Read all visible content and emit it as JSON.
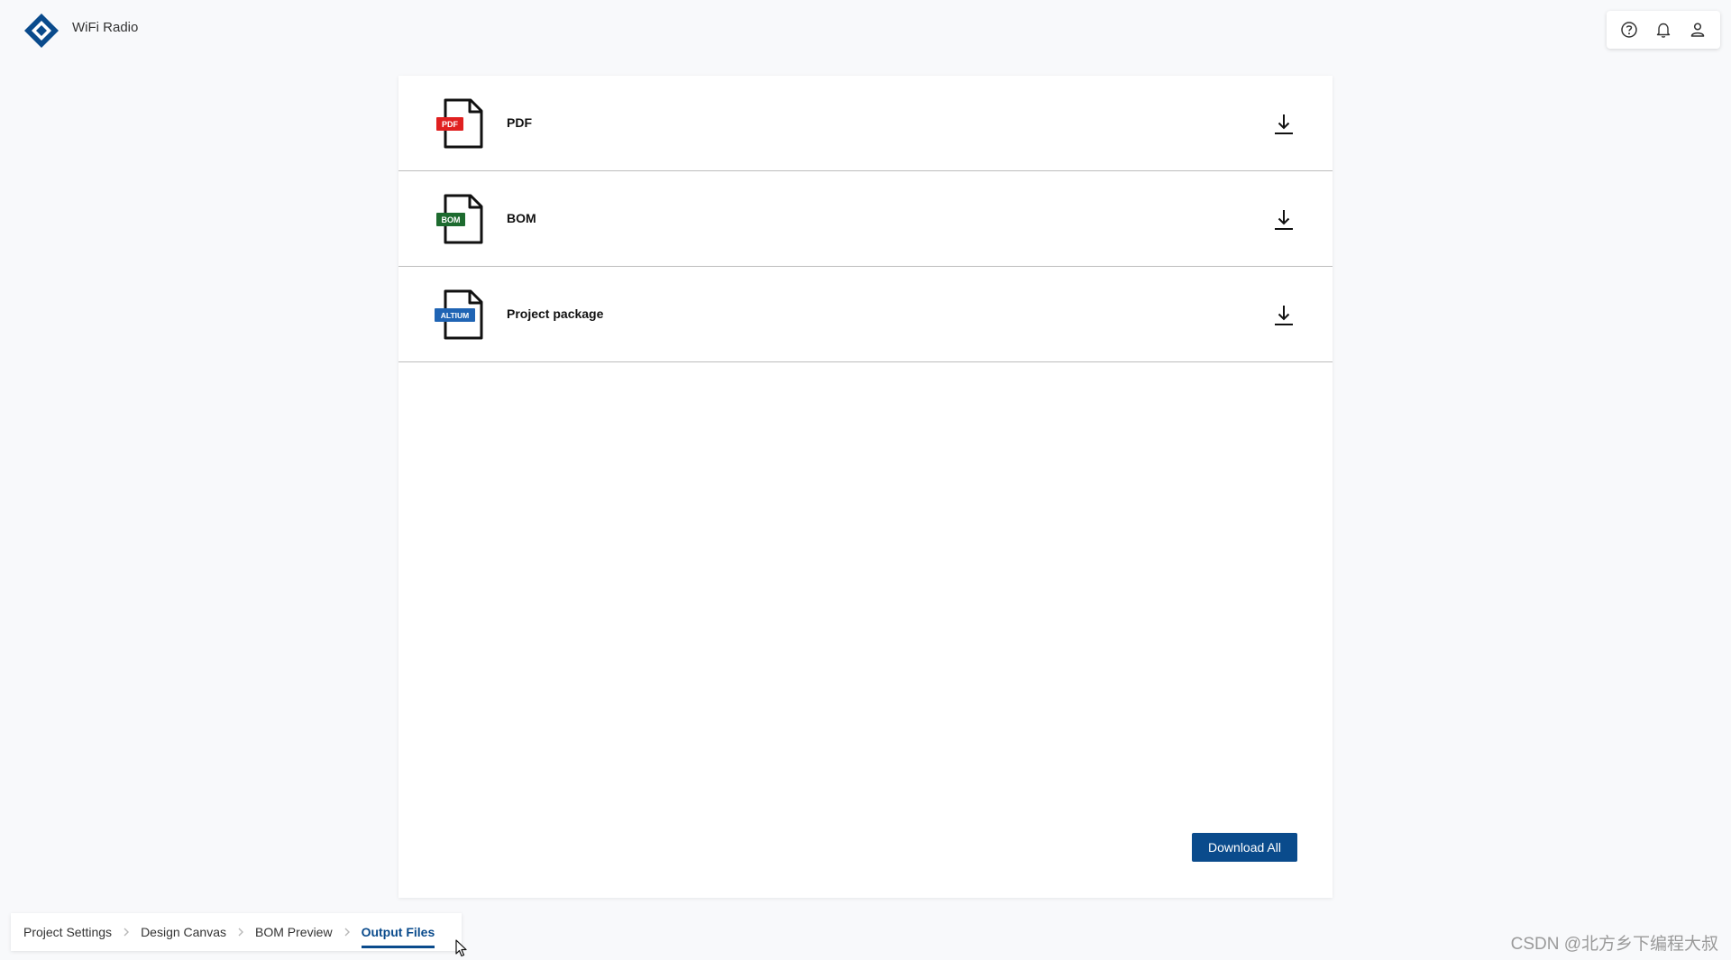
{
  "header": {
    "title": "WiFi Radio",
    "logo_color": "#0a4b8c",
    "actions": [
      {
        "name": "help-icon"
      },
      {
        "name": "bell-icon"
      },
      {
        "name": "user-icon"
      }
    ]
  },
  "files": [
    {
      "label": "PDF",
      "badge": "PDF",
      "badge_color": "#e02020",
      "icon": "pdf-file-icon"
    },
    {
      "label": "BOM",
      "badge": "BOM",
      "badge_color": "#1d6b2f",
      "icon": "bom-file-icon"
    },
    {
      "label": "Project package",
      "badge": "ALTIUM",
      "badge_color": "#1f64b4",
      "icon": "altium-file-icon"
    }
  ],
  "download_all_label": "Download All",
  "accent_color": "#0a4b8c",
  "steps": [
    {
      "label": "Project Settings",
      "active": false
    },
    {
      "label": "Design Canvas",
      "active": false
    },
    {
      "label": "BOM Preview",
      "active": false
    },
    {
      "label": "Output Files",
      "active": true
    }
  ],
  "watermark": "CSDN @北方乡下编程大叔"
}
